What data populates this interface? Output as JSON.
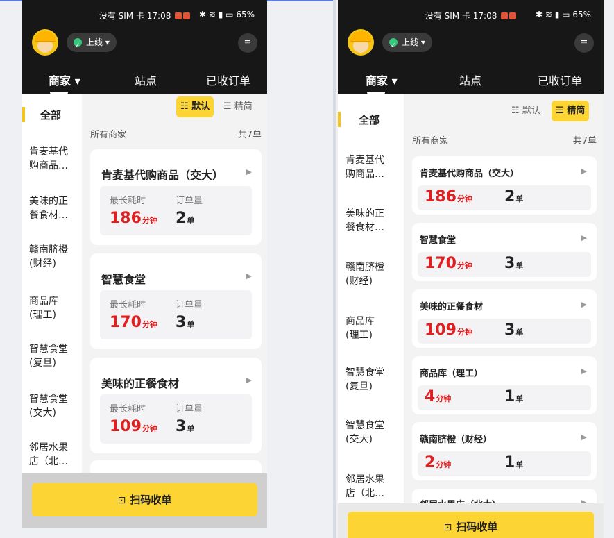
{
  "status_bar": {
    "carrier_time": "没有 SIM 卡 17:08",
    "battery": "65%",
    "signal_icons": "✱ ≋ ▮ ▭"
  },
  "topbar": {
    "online_status": "上线 ▾",
    "search_icon": "search-list-icon"
  },
  "tabs": {
    "merchant": "商家 ▾",
    "station": "站点",
    "received_orders": "已收订单"
  },
  "sidebar": {
    "left": [
      "全部",
      "肯麦基代\n购商品…",
      "美味的正\n餐食材…",
      "赣南脐橙\n(财经)",
      "商品库\n(理工)",
      "智慧食堂\n(复旦)",
      "智慧食堂\n(交大)",
      "邻居水果\n店（北…"
    ],
    "right": [
      "全部",
      "肯麦基代\n购商品…",
      "美味的正\n餐食材…",
      "赣南脐橙\n(财经)",
      "商品库\n(理工)",
      "智慧食堂\n(复旦)",
      "智慧食堂\n(交大)",
      "邻居水果\n店（北…"
    ]
  },
  "view_toggle": {
    "default_label": "默认",
    "compact_label": "精简",
    "default_icon": "☷",
    "compact_icon": "☰"
  },
  "list_header": {
    "title": "所有商家",
    "count": "共7单"
  },
  "labels": {
    "max_time": "最长耗时",
    "order_count": "订单量",
    "minutes_unit": "分钟",
    "orders_unit": "单"
  },
  "left_cards": [
    {
      "name": "肯麦基代购商品（交大）",
      "time": "186",
      "orders": "2"
    },
    {
      "name": "智慧食堂",
      "time": "170",
      "orders": "3"
    },
    {
      "name": "美味的正餐食材",
      "time": "109",
      "orders": "3"
    }
  ],
  "right_cards": [
    {
      "name": "肯麦基代购商品（交大）",
      "time": "186",
      "orders": "2"
    },
    {
      "name": "智慧食堂",
      "time": "170",
      "orders": "3"
    },
    {
      "name": "美味的正餐食材",
      "time": "109",
      "orders": "3"
    },
    {
      "name": "商品库（理工）",
      "time": "4",
      "orders": "1"
    },
    {
      "name": "赣南脐橙（财经）",
      "time": "2",
      "orders": "1"
    },
    {
      "name": "邻居水果店（北大）",
      "time": "",
      "orders": ""
    }
  ],
  "footer": {
    "scan_label": "扫码收单",
    "scan_icon": "⊡"
  }
}
